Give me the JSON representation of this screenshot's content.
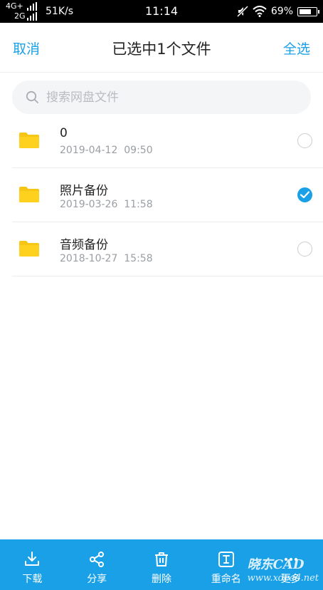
{
  "status_bar": {
    "network_top": "4G+",
    "network_bottom": "2G",
    "speed": "51K/s",
    "time": "11:14",
    "battery": "69%"
  },
  "header": {
    "cancel_label": "取消",
    "title": "已选中1个文件",
    "select_all_label": "全选"
  },
  "search": {
    "placeholder": "搜索网盘文件"
  },
  "files": [
    {
      "name": "0",
      "date": "2019-04-12  09:50",
      "selected": false,
      "icon": "folder-icon"
    },
    {
      "name": "照片备份",
      "date": "2019-03-26  11:58",
      "selected": true,
      "icon": "folder-icon"
    },
    {
      "name": "音频备份",
      "date": "2018-10-27  15:58",
      "selected": false,
      "icon": "folder-icon"
    }
  ],
  "toolbar": {
    "download_label": "下载",
    "share_label": "分享",
    "delete_label": "删除",
    "rename_label": "重命名",
    "more_label": "更多"
  },
  "watermark": {
    "main": "晓东CAD",
    "url": "www.xdcad.net"
  },
  "colors": {
    "accent": "#1aa0e6",
    "folder": "#f7c614",
    "status_bar": "#000000"
  }
}
